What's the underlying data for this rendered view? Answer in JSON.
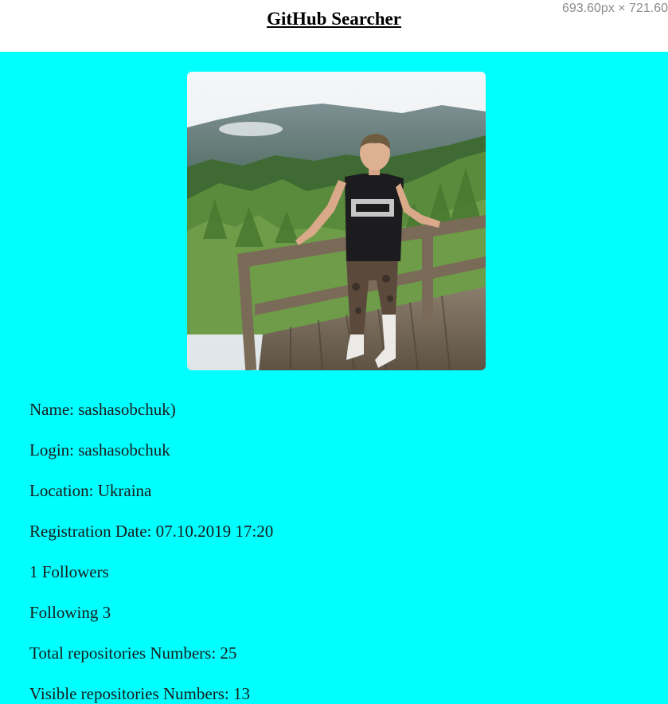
{
  "header": {
    "title": "GitHub Searcher",
    "dimensions_readout": "693.60px × 721.60"
  },
  "profile": {
    "avatar_alt": "sashasobchuk avatar",
    "name_line": "Name: sashasobchuk)",
    "login_line": "Login: sashasobchuk",
    "location_line": "Location: Ukraina",
    "registration_line": "Registration Date: 07.10.2019 17:20",
    "followers_line": "1 Followers",
    "following_line": "Following 3",
    "total_repos_line": "Total repositories Numbers: 25",
    "visible_repos_line": "Visible repositories Numbers: 13"
  },
  "colors": {
    "page_background": "#00ffff",
    "header_background": "#ffffff",
    "text": "#1a1a1a"
  }
}
